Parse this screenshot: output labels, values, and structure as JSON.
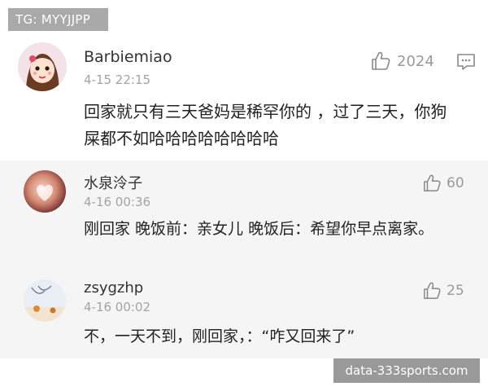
{
  "watermark_top": "TG: MYYJJPP",
  "main_comment": {
    "username": "Barbiemiao",
    "time": "4-15 22:15",
    "likes": "2024",
    "content": "回家就只有三天爸妈是稀罕你的 ，过了三天，你狗屎都不如哈哈哈哈哈哈哈哈"
  },
  "replies": [
    {
      "username": "水泉泠子",
      "time": "4-16 00:36",
      "likes": "60",
      "content": "刚回家 晚饭前：亲女儿 晚饭后：希望你早点离家。"
    },
    {
      "username": "zsygzhp",
      "time": "4-16 00:02",
      "likes": "25",
      "content": "不，一天不到，刚回家，：“咋又回来了”"
    }
  ],
  "watermark_bottom": "data-333sports.com"
}
